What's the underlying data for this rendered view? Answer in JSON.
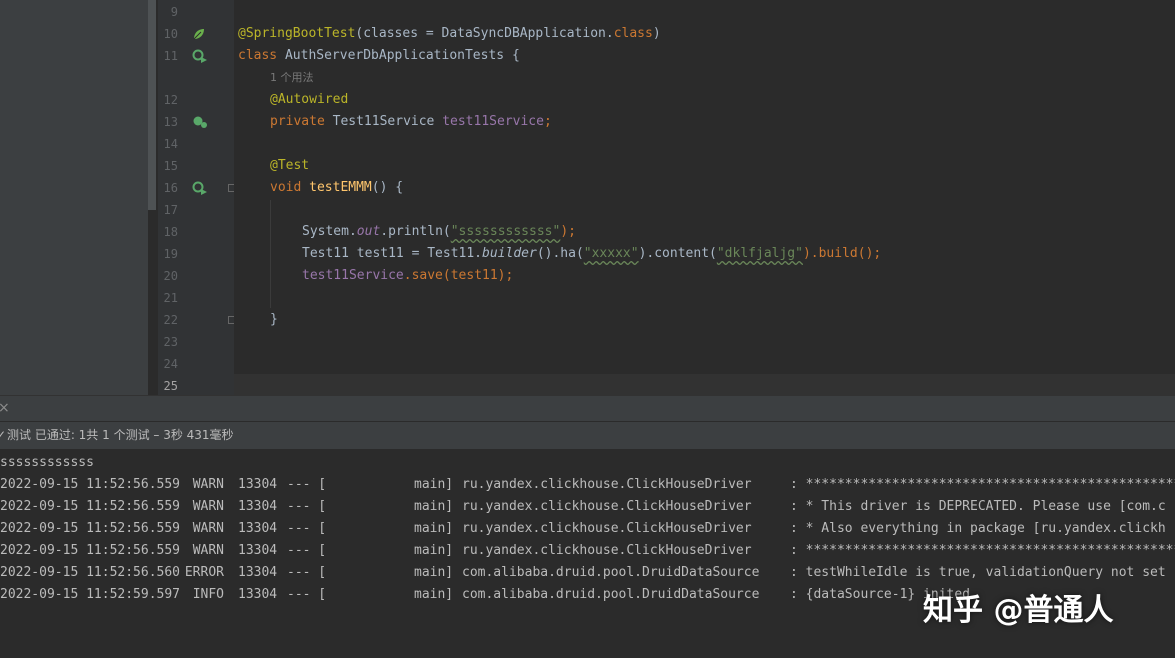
{
  "editor": {
    "line_numbers": [
      "9",
      "10",
      "11",
      "12",
      "13",
      "14",
      "15",
      "16",
      "17",
      "18",
      "19",
      "20",
      "21",
      "22",
      "23",
      "24",
      "25"
    ],
    "code": {
      "l10": {
        "annotation": "@SpringBootTest",
        "args": "(classes = DataSyncDBApplication.",
        "kw": "class",
        "close": ")"
      },
      "l11": {
        "kw": "class",
        "name": " AuthServerDbApplicationTests {"
      },
      "usage_hint": "1 个用法",
      "l12": "@Autowired",
      "l13": {
        "kw": "private",
        "type": " Test11Service ",
        "field": "test11Service",
        "semi": ";"
      },
      "l15": "@Test",
      "l16": {
        "kw": "void",
        "method": " testEMMM",
        "rest": "() {"
      },
      "l18": {
        "a": "System.",
        "b": "out",
        "c": ".println(",
        "str": "\"ssssssssssss\"",
        "d": ");"
      },
      "l19": {
        "a": "Test11 test11 = Test11.",
        "b": "builder",
        "c": "().ha(",
        "s1": "\"xxxxx\"",
        "d": ").content(",
        "s2": "\"dklfjaljg\"",
        "e": ").build();"
      },
      "l20": {
        "field": "test11Service",
        "rest": ".save(test11);"
      },
      "l22": "}"
    }
  },
  "test_panel": {
    "close_icon": "close-icon",
    "status": "测试 已通过: 1共 1 个测试 – 3秒 431毫秒"
  },
  "console": {
    "first_line": "ssssssssssss",
    "logs": [
      {
        "time": "2022-09-15 11:52:56.559",
        "level": "WARN",
        "pid": "13304",
        "sep": "--- [",
        "thread": "main]",
        "logger": "ru.yandex.clickhouse.ClickHouseDriver",
        "msg": ": ****************************************************"
      },
      {
        "time": "2022-09-15 11:52:56.559",
        "level": "WARN",
        "pid": "13304",
        "sep": "--- [",
        "thread": "main]",
        "logger": "ru.yandex.clickhouse.ClickHouseDriver",
        "msg": ": * This driver is DEPRECATED. Please use [com.c"
      },
      {
        "time": "2022-09-15 11:52:56.559",
        "level": "WARN",
        "pid": "13304",
        "sep": "--- [",
        "thread": "main]",
        "logger": "ru.yandex.clickhouse.ClickHouseDriver",
        "msg": ": * Also everything in package [ru.yandex.clickh"
      },
      {
        "time": "2022-09-15 11:52:56.559",
        "level": "WARN",
        "pid": "13304",
        "sep": "--- [",
        "thread": "main]",
        "logger": "ru.yandex.clickhouse.ClickHouseDriver",
        "msg": ": ****************************************************"
      },
      {
        "time": "2022-09-15 11:52:56.560",
        "level": "ERROR",
        "pid": "13304",
        "sep": "--- [",
        "thread": "main]",
        "logger": "com.alibaba.druid.pool.DruidDataSource",
        "msg": ": testWhileIdle is true, validationQuery not set"
      },
      {
        "time": "2022-09-15 11:52:59.597",
        "level": "INFO",
        "pid": "13304",
        "sep": "--- [",
        "thread": "main]",
        "logger": "com.alibaba.druid.pool.DruidDataSource",
        "msg": ": {dataSource-1} inited"
      }
    ]
  },
  "watermark": "知乎 @普通人",
  "colors": {
    "keyword": "#cc7832",
    "annotation": "#bbb529",
    "string": "#6a8759",
    "field": "#9876aa",
    "method": "#ffc66d",
    "text": "#a9b7c6",
    "run_icon": "#59a869"
  }
}
